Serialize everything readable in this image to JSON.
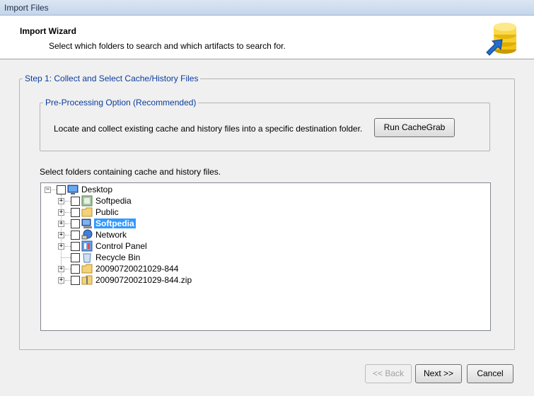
{
  "window": {
    "title": "Import Files"
  },
  "header": {
    "title": "Import Wizard",
    "subtitle": "Select which folders to search and which artifacts to search for.",
    "logo_icon": "database-import-icon"
  },
  "step1": {
    "legend": "Step 1: Collect and Select Cache/History Files",
    "preprocessing": {
      "legend": "Pre-Processing Option (Recommended)",
      "description": "Locate and collect existing cache and history files into a specific destination folder.",
      "run_button": "Run CacheGrab"
    },
    "select_label": "Select folders containing cache and history files.",
    "tree": {
      "root": {
        "label": "Desktop",
        "icon": "desktop-icon",
        "expanded": true,
        "checked": false
      },
      "items": [
        {
          "label": "Softpedia",
          "icon": "user-folder-icon",
          "has_children": true,
          "checked": false,
          "selected": false
        },
        {
          "label": "Public",
          "icon": "folder-icon",
          "has_children": true,
          "checked": false,
          "selected": false
        },
        {
          "label": "Softpedia",
          "icon": "computer-icon",
          "has_children": true,
          "checked": false,
          "selected": true
        },
        {
          "label": "Network",
          "icon": "network-icon",
          "has_children": true,
          "checked": false,
          "selected": false
        },
        {
          "label": "Control Panel",
          "icon": "control-panel-icon",
          "has_children": true,
          "checked": false,
          "selected": false
        },
        {
          "label": "Recycle Bin",
          "icon": "recycle-bin-icon",
          "has_children": false,
          "checked": false,
          "selected": false
        },
        {
          "label": "20090720021029-844",
          "icon": "folder-icon",
          "has_children": true,
          "checked": false,
          "selected": false
        },
        {
          "label": "20090720021029-844.zip",
          "icon": "zip-folder-icon",
          "has_children": true,
          "checked": false,
          "selected": false
        }
      ]
    }
  },
  "footer": {
    "back_button": "<< Back",
    "next_button": "Next >>",
    "cancel_button": "Cancel",
    "back_enabled": false
  },
  "colors": {
    "legend_text": "#0b3c9c",
    "selection": "#3399ff",
    "window_bg": "#f0f0f0"
  }
}
